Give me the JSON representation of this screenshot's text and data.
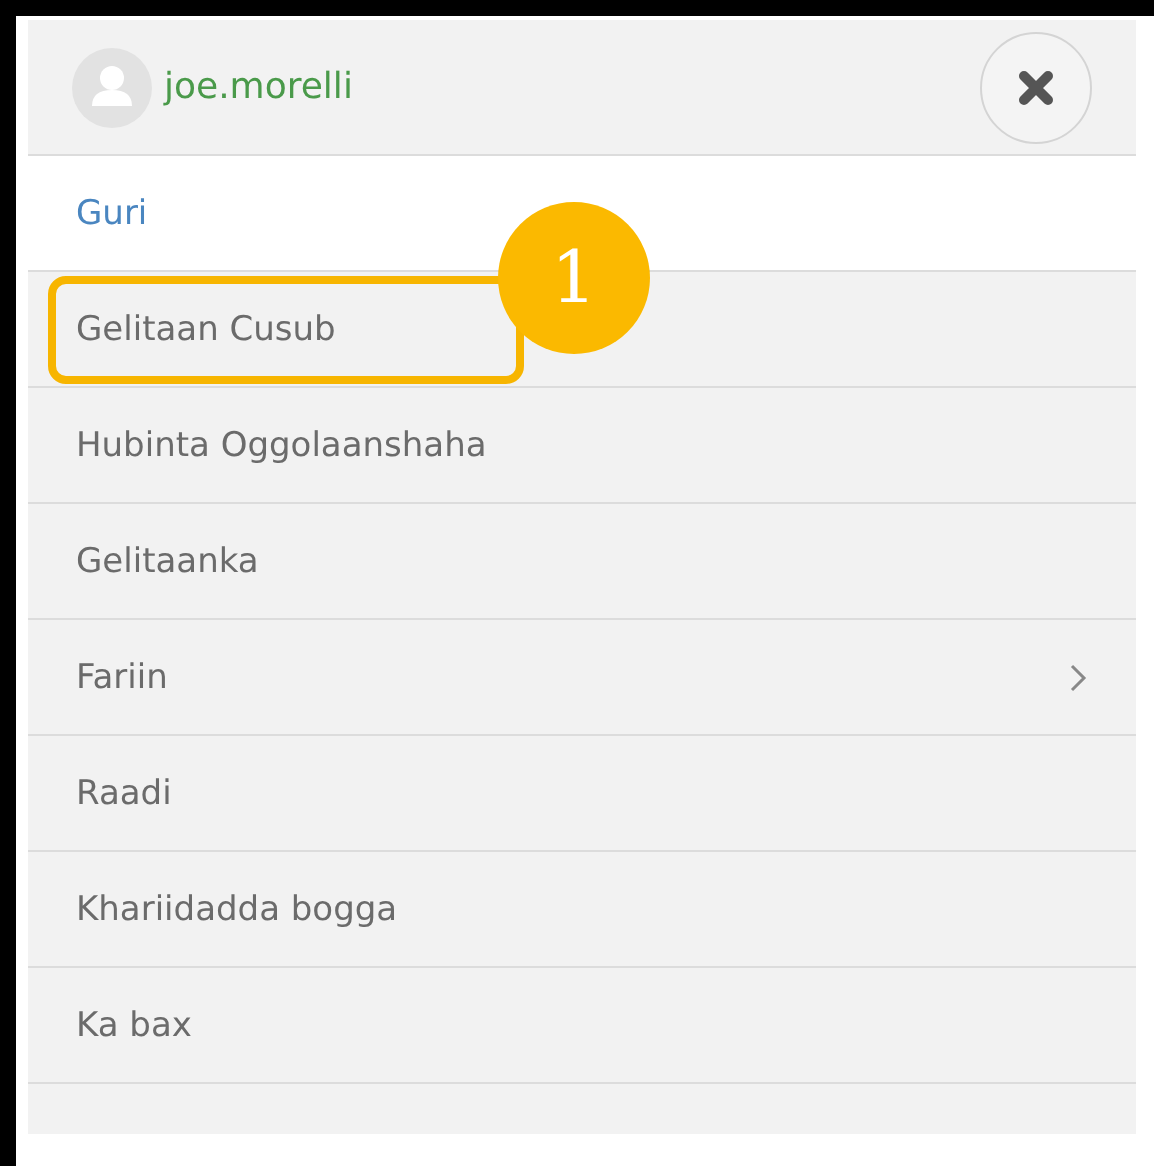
{
  "user": {
    "name": "joe.morelli"
  },
  "menu": [
    {
      "label": "Guri",
      "selected": true,
      "kind": "link"
    },
    {
      "label": "Gelitaan Cusub",
      "selected": false,
      "kind": "link",
      "callout": "1"
    },
    {
      "label": "Hubinta Oggolaanshaha",
      "selected": false,
      "kind": "link"
    },
    {
      "label": "Gelitaanka",
      "selected": false,
      "kind": "link"
    },
    {
      "label": "Fariin",
      "selected": false,
      "kind": "submenu"
    },
    {
      "label": "Raadi",
      "selected": false,
      "kind": "link"
    },
    {
      "label": "Khariidadda bogga",
      "selected": false,
      "kind": "link"
    },
    {
      "label": "Ka bax",
      "selected": false,
      "kind": "link"
    }
  ]
}
